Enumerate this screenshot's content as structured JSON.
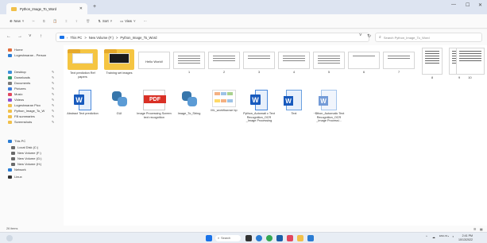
{
  "window": {
    "tab_title": "Python_Image_To_Word",
    "new_tab": "+",
    "minimize": "—",
    "maximize": "☐",
    "close": "✕"
  },
  "toolbar": {
    "new_label": "New",
    "sort_label": "Sort",
    "view_label": "View",
    "more_label": "···"
  },
  "address": {
    "crumbs": [
      "This PC",
      ">",
      "New Volume (F:)",
      ">",
      "Python_Image_To_Word"
    ],
    "search_placeholder": "Search Python_Image_To_Word"
  },
  "sidebar": {
    "items": [
      {
        "label": "Home",
        "color": "#e06c3c"
      },
      {
        "label": "Logeshwaran - Person",
        "color": "#2b7cd3"
      },
      {
        "label": "Desktop",
        "color": "#3a8fd9",
        "pin": true
      },
      {
        "label": "Downloads",
        "color": "#2f9e6e",
        "pin": true
      },
      {
        "label": "Documents",
        "color": "#7a7a7a",
        "pin": true
      },
      {
        "label": "Pictures",
        "color": "#3b7ddd",
        "pin": true
      },
      {
        "label": "Music",
        "color": "#e2475e",
        "pin": true
      },
      {
        "label": "Videos",
        "color": "#8e4fd1",
        "pin": true
      },
      {
        "label": "Logeshwaran Pico",
        "color": "#f1c04a",
        "pin": true
      },
      {
        "label": "Python_Image_To_W",
        "color": "#f1c04a",
        "pin": true
      },
      {
        "label": "FB summaries",
        "color": "#f1c04a",
        "pin": true
      },
      {
        "label": "Screenshots",
        "color": "#f1c04a",
        "pin": true
      },
      {
        "label": "This PC",
        "color": "#2b7cd3"
      },
      {
        "label": "Local Disk (C:)",
        "color": "#6a6a6a"
      },
      {
        "label": "New Volume (F:)",
        "color": "#6a6a6a"
      },
      {
        "label": "New Volume (G:)",
        "color": "#6a6a6a"
      },
      {
        "label": "New Volume (H:)",
        "color": "#6a6a6a"
      },
      {
        "label": "Network",
        "color": "#2b7cd3"
      },
      {
        "label": "Linux",
        "color": "#333333"
      }
    ]
  },
  "files": {
    "row1": [
      "Text prediction Ref papers",
      "Training set images",
      "Hello World!",
      "1",
      "2",
      "3",
      "4",
      "5",
      "6",
      "7",
      "8",
      "9",
      "10"
    ],
    "row2": [
      "Abstract Text prediction",
      "GUI",
      "Image Processing Screen text recognition",
      "Image_To_String",
      "ML_workflow.we bp",
      "Python_Automati c Text Recognition_OCR _Image Processing",
      "Text",
      "~$thon_Automatic Text Recognition_OCR _Image Processi..."
    ]
  },
  "status": {
    "count": "26 items"
  },
  "taskbar": {
    "search_label": "Search",
    "tray_lang": "ENG IN",
    "time": "2:41 PM",
    "date": "10/13/2022"
  }
}
